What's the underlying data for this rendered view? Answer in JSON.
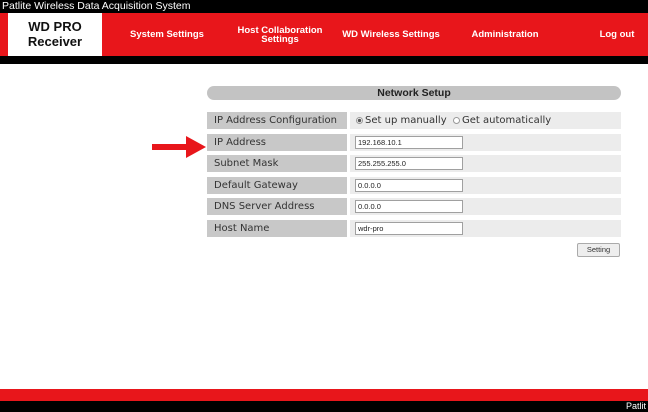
{
  "window": {
    "title": "Patlite Wireless Data Acquisition System"
  },
  "brand": {
    "line1": "WD PRO",
    "line2": "Receiver"
  },
  "nav": {
    "items": [
      {
        "label": "System Settings"
      },
      {
        "label_line1": "Host Collaboration",
        "label_line2": "Settings"
      },
      {
        "label": "WD Wireless Settings"
      },
      {
        "label": "Administration"
      },
      {
        "label": "Log out"
      }
    ]
  },
  "network_setup": {
    "title": "Network Setup",
    "ip_config": {
      "label": "IP Address Configuration",
      "options": [
        "Set up manually",
        "Get automatically"
      ],
      "selected": "Set up manually"
    },
    "fields": [
      {
        "label": "IP Address",
        "value": "192.168.10.1"
      },
      {
        "label": "Subnet Mask",
        "value": "255.255.255.0"
      },
      {
        "label": "Default Gateway",
        "value": "0.0.0.0"
      },
      {
        "label": "DNS Server Address",
        "value": "0.0.0.0"
      },
      {
        "label": "Host Name",
        "value": "wdr-pro"
      }
    ],
    "setting_button": "Setting"
  },
  "annotation": {
    "arrow_color": "#e8161b",
    "arrow_target": "IP Address"
  },
  "footer": {
    "text": "Patlit"
  },
  "colors": {
    "accent": "#e8161b",
    "header_bar": "#000000"
  }
}
